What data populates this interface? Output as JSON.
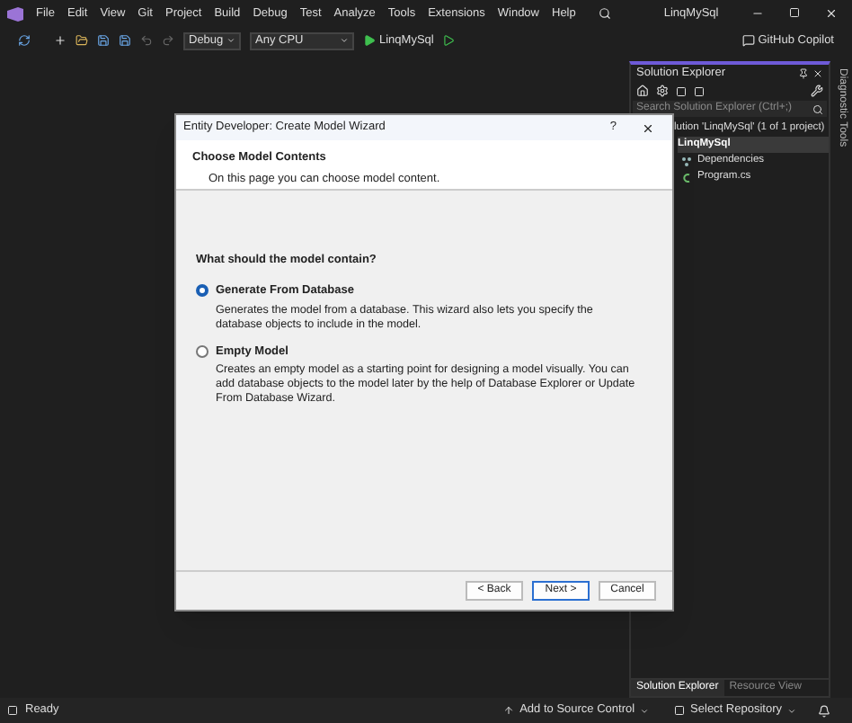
{
  "menu": [
    "File",
    "Edit",
    "View",
    "Git",
    "Project",
    "Build",
    "Debug",
    "Test",
    "Analyze",
    "Tools",
    "Extensions",
    "Window",
    "Help"
  ],
  "window": {
    "title": "LinqMySql"
  },
  "toolbar": {
    "configuration": "Debug",
    "platform": "Any CPU",
    "run_target": "LinqMySql",
    "copilot": "GitHub Copilot"
  },
  "solution_explorer": {
    "title": "Solution Explorer",
    "search": {
      "placeholder": "Search Solution Explorer (Ctrl+;)"
    },
    "tree": [
      {
        "label": "lution 'LinqMySql' (1 of 1 project)",
        "selected": false,
        "children": [
          {
            "label": "LinqMySql",
            "selected": true,
            "children": [
              {
                "label": "Dependencies",
                "kind": "dependencies",
                "selected": false
              },
              {
                "label": "Program.cs",
                "kind": "csharp",
                "selected": false
              }
            ]
          }
        ]
      }
    ],
    "tabs": [
      {
        "label": "Solution Explorer",
        "selected": true
      },
      {
        "label": "Resource View",
        "selected": false
      }
    ]
  },
  "side_tab": "Diagnostic Tools",
  "dialog": {
    "title": "Entity Developer: Create Model Wizard",
    "help": "?",
    "header_title": "Choose Model Contents",
    "header_subtitle": "On this page you can choose model content.",
    "question": "What should the model contain?",
    "options": [
      {
        "label": "Generate From Database",
        "description": "Generates the model from a database. This wizard also lets you specify the database objects to include in the model.",
        "selected": true
      },
      {
        "label": "Empty Model",
        "description": "Creates an empty model as a starting point for designing a model visually. You can add database objects to the model later by the help of Database Explorer or Update From Database Wizard.",
        "selected": false
      }
    ],
    "buttons": [
      {
        "label": "< Back",
        "default": false
      },
      {
        "label": "Next >",
        "default": true
      },
      {
        "label": "Cancel",
        "default": false
      }
    ]
  },
  "status_bar": {
    "status": "Ready",
    "source_control": "Add to Source Control",
    "repository": "Select Repository"
  }
}
